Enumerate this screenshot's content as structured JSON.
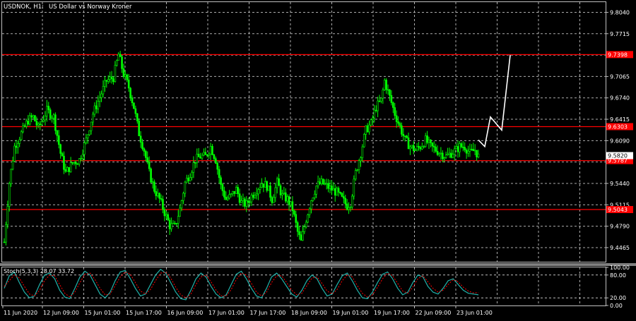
{
  "header": {
    "symbol_timeframe": "USDNOK, H1:",
    "description": "US Dollar vs Norway Kroner"
  },
  "colors": {
    "background": "#000000",
    "grid": "#c0c0c0",
    "bull_candle": "#00ff00",
    "level_line": "#ff0000",
    "level_tag": "#ff0000",
    "forecast_arrow": "#ffffff",
    "stoch_main": "#20b2aa",
    "stoch_signal": "#ff0000",
    "separator": "#808080"
  },
  "chart_data": [
    {
      "type": "candlestick",
      "symbol": "USDNOK",
      "timeframe": "H1",
      "title": "USDNOK, H1:  US Dollar vs Norway Kroner",
      "price_axis_ticks": [
        "9.8040",
        "9.7715",
        "9.7390",
        "9.7065",
        "9.6740",
        "9.6415",
        "9.6090",
        "9.5765",
        "9.5440",
        "9.5115",
        "9.4790",
        "9.4465"
      ],
      "ylim": [
        9.425,
        9.8195
      ],
      "time_axis_labels": [
        "11 Jun 2020",
        "12 Jun 09:00",
        "15 Jun 01:00",
        "15 Jun 17:00",
        "16 Jun 09:00",
        "17 Jun 01:00",
        "17 Jun 17:00",
        "18 Jun 09:00",
        "19 Jun 01:00",
        "19 Jun 17:00",
        "22 Jun 09:00",
        "23 Jun 01:00"
      ],
      "horizontal_levels": [
        {
          "price": 9.7398,
          "label": "9.7398"
        },
        {
          "price": 9.6303,
          "label": "9.6303"
        },
        {
          "price": 9.5787,
          "label": "9.5787"
        },
        {
          "price": 9.5043,
          "label": "9.5043"
        }
      ],
      "last_price_tag": "9.5820",
      "close_path_knots": [
        [
          0,
          9.455
        ],
        [
          3,
          9.545
        ],
        [
          6,
          9.6
        ],
        [
          10,
          9.62
        ],
        [
          14,
          9.64
        ],
        [
          17,
          9.645
        ],
        [
          20,
          9.628
        ],
        [
          25,
          9.655
        ],
        [
          29,
          9.645
        ],
        [
          33,
          9.59
        ],
        [
          36,
          9.56
        ],
        [
          40,
          9.575
        ],
        [
          44,
          9.58
        ],
        [
          48,
          9.61
        ],
        [
          52,
          9.65
        ],
        [
          56,
          9.675
        ],
        [
          60,
          9.7
        ],
        [
          64,
          9.705
        ],
        [
          67,
          9.74
        ],
        [
          70,
          9.71
        ],
        [
          73,
          9.69
        ],
        [
          76,
          9.66
        ],
        [
          79,
          9.62
        ],
        [
          82,
          9.595
        ],
        [
          85,
          9.56
        ],
        [
          88,
          9.535
        ],
        [
          91,
          9.52
        ],
        [
          94,
          9.5
        ],
        [
          97,
          9.48
        ],
        [
          100,
          9.478
        ],
        [
          103,
          9.505
        ],
        [
          106,
          9.545
        ],
        [
          109,
          9.56
        ],
        [
          112,
          9.58
        ],
        [
          115,
          9.585
        ],
        [
          118,
          9.585
        ],
        [
          121,
          9.6
        ],
        [
          124,
          9.58
        ],
        [
          127,
          9.54
        ],
        [
          130,
          9.52
        ],
        [
          133,
          9.525
        ],
        [
          136,
          9.535
        ],
        [
          139,
          9.515
        ],
        [
          142,
          9.512
        ],
        [
          145,
          9.525
        ],
        [
          148,
          9.535
        ],
        [
          151,
          9.545
        ],
        [
          154,
          9.54
        ],
        [
          157,
          9.52
        ],
        [
          160,
          9.545
        ],
        [
          163,
          9.525
        ],
        [
          166,
          9.52
        ],
        [
          169,
          9.505
        ],
        [
          172,
          9.47
        ],
        [
          174,
          9.455
        ],
        [
          177,
          9.49
        ],
        [
          180,
          9.52
        ],
        [
          183,
          9.54
        ],
        [
          186,
          9.545
        ],
        [
          189,
          9.54
        ],
        [
          192,
          9.535
        ],
        [
          195,
          9.53
        ],
        [
          198,
          9.52
        ],
        [
          201,
          9.51
        ],
        [
          203,
          9.515
        ],
        [
          206,
          9.56
        ],
        [
          209,
          9.59
        ],
        [
          212,
          9.625
        ],
        [
          215,
          9.635
        ],
        [
          218,
          9.66
        ],
        [
          221,
          9.67
        ],
        [
          223,
          9.7
        ],
        [
          226,
          9.675
        ],
        [
          229,
          9.65
        ],
        [
          232,
          9.63
        ],
        [
          235,
          9.61
        ],
        [
          238,
          9.6
        ],
        [
          241,
          9.595
        ],
        [
          244,
          9.6
        ],
        [
          247,
          9.61
        ],
        [
          250,
          9.6
        ],
        [
          253,
          9.595
        ],
        [
          256,
          9.59
        ],
        [
          259,
          9.585
        ],
        [
          262,
          9.59
        ],
        [
          265,
          9.595
        ],
        [
          267,
          9.6
        ],
        [
          270,
          9.6
        ],
        [
          273,
          9.59
        ],
        [
          276,
          9.595
        ],
        [
          278,
          9.585
        ]
      ],
      "forecast_path": [
        [
          9.61,
          9.6
        ],
        [
          9.6,
          9.645
        ],
        [
          9.645,
          9.625
        ],
        [
          9.625,
          9.739
        ]
      ]
    },
    {
      "type": "line",
      "indicator": "Stochastic",
      "label": "Stoch(5,3,3) 28.07 33.72",
      "params": [
        5,
        3,
        3
      ],
      "main_value": 28.07,
      "signal_value": 33.72,
      "axis_ticks": [
        "100.00",
        "80.00",
        "20.00",
        "0.00"
      ],
      "ylim": [
        0,
        100
      ],
      "levels": [
        20,
        80
      ],
      "series": [
        {
          "name": "main",
          "values": [
            45,
            78,
            88,
            60,
            35,
            20,
            25,
            55,
            80,
            85,
            70,
            40,
            22,
            18,
            45,
            75,
            90,
            80,
            55,
            30,
            20,
            35,
            65,
            88,
            92,
            70,
            45,
            25,
            30,
            55,
            80,
            95,
            85,
            60,
            35,
            18,
            15,
            40,
            70,
            85,
            75,
            50,
            30,
            20,
            28,
            55,
            82,
            90,
            70,
            45,
            25,
            20,
            45,
            75,
            85,
            70,
            50,
            30,
            22,
            40,
            65,
            80,
            70,
            45,
            25,
            30,
            55,
            78,
            85,
            65,
            40,
            20,
            18,
            35,
            60,
            82,
            88,
            70,
            45,
            28,
            35,
            60,
            80,
            75,
            50,
            35,
            30,
            45,
            65,
            70,
            55,
            40,
            32,
            30,
            28
          ]
        },
        {
          "name": "signal",
          "values": [
            50,
            65,
            80,
            72,
            50,
            30,
            25,
            40,
            65,
            80,
            78,
            55,
            32,
            22,
            35,
            60,
            82,
            85,
            68,
            45,
            28,
            30,
            52,
            75,
            88,
            82,
            60,
            38,
            30,
            42,
            65,
            85,
            88,
            72,
            48,
            28,
            20,
            30,
            55,
            75,
            80,
            62,
            40,
            25,
            25,
            42,
            68,
            85,
            80,
            58,
            35,
            25,
            35,
            60,
            78,
            78,
            60,
            40,
            28,
            32,
            52,
            72,
            75,
            58,
            38,
            30,
            42,
            65,
            80,
            75,
            52,
            32,
            22,
            28,
            48,
            70,
            85,
            78,
            58,
            38,
            32,
            48,
            70,
            78,
            62,
            45,
            35,
            40,
            55,
            68,
            62,
            48,
            38,
            33,
            33.72
          ]
        }
      ]
    }
  ]
}
